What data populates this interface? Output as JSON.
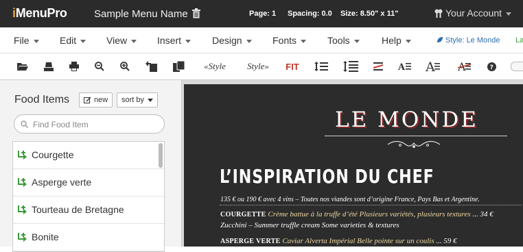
{
  "header": {
    "logo_i": "i",
    "logo_rest": "MenuPro",
    "menu_name": "Sample Menu Name",
    "page": "Page: 1",
    "spacing": "Spacing: 0.0",
    "size": "Size: 8.50\" x 11\"",
    "account": "Your Account"
  },
  "menubar": {
    "items": [
      "File",
      "Edit",
      "View",
      "Insert",
      "Design",
      "Fonts",
      "Tools",
      "Help"
    ],
    "style_label": "Style: Le Monde",
    "la_label": "La"
  },
  "toolbar": {
    "style_left": "«Style",
    "style_right": "Style»",
    "fit": "FIT",
    "icons": [
      "open-folder-icon",
      "save-icon",
      "print-icon",
      "zoom-out-icon",
      "zoom-in-icon",
      "move-page-icon",
      "copy-page-icon",
      "line-spacing-icon",
      "paragraph-spacing-icon",
      "strikethrough-spacing-icon",
      "font-size-decrease-icon",
      "font-size-increase-icon",
      "font-size-strike-icon",
      "help-icon"
    ]
  },
  "food_items": {
    "title": "Food Items",
    "new_label": "new",
    "sort_label": "sort by",
    "search_placeholder": "Find Food Item",
    "items": [
      "Courgette",
      "Asperge verte",
      "Tourteau de Bretagne",
      "Bonite"
    ]
  },
  "preview": {
    "title": "LE MONDE",
    "section": "L’INSPIRATION DU CHEF",
    "intro": "135 € ou 190 € avec 4 vins – Toutes nos viandes sont d’origine France, Pays Bas et Argentine.",
    "dish1_name": "COURGETTE",
    "dish1_desc": "Crème battue à la truffe d’été Plusieurs variétés, plusieurs textures",
    "dish1_price": "... 34 €",
    "dish1_en": "Zucchini – Summer truffle cream Some varieties & textures",
    "dish2_name": "ASPERGE VERTE",
    "dish2_desc": "Caviar Alverta Impérial Belle pointe sur un coulis",
    "dish2_price": "... 59 €"
  },
  "colors": {
    "topbar": "#2b2b2b",
    "accent_red": "#c0392b",
    "link_blue": "#2a6fb0",
    "add_green": "#3a9a3a",
    "page_bg": "#2c2c2c"
  }
}
